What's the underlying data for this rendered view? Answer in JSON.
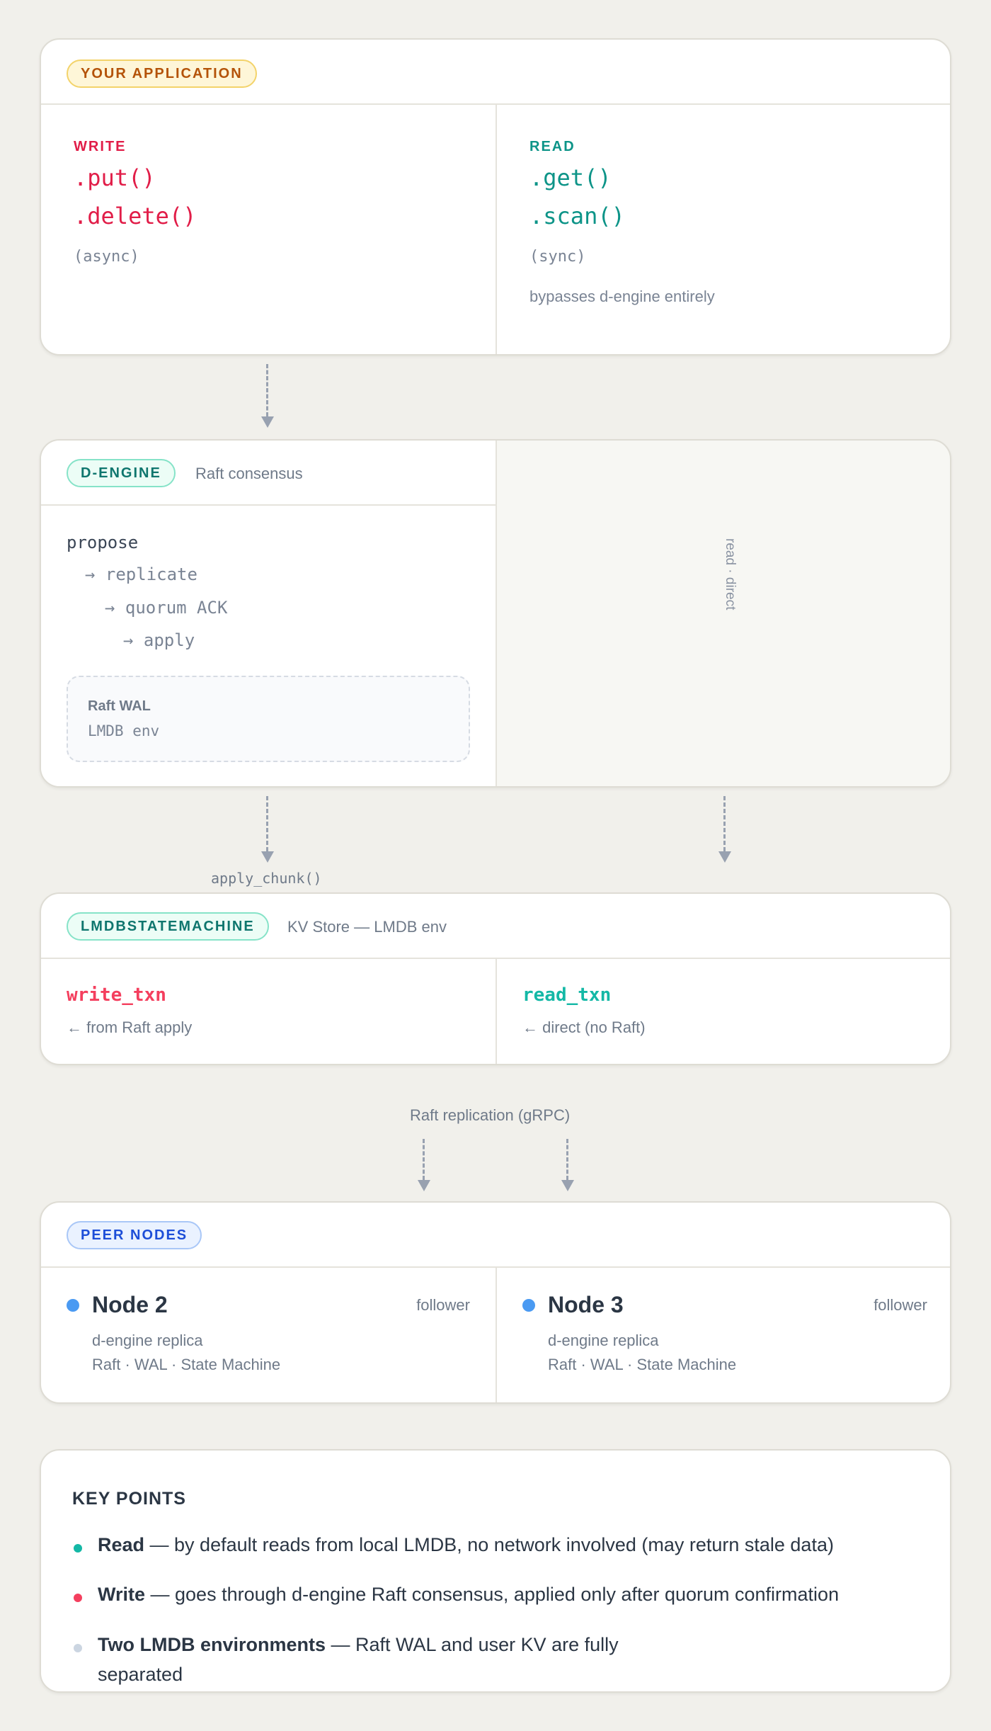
{
  "app": {
    "badge": "YOUR APPLICATION",
    "write": {
      "label": "WRITE",
      "m1": ".put()",
      "m2": ".delete()",
      "mode": "(async)"
    },
    "read": {
      "label": "READ",
      "m1": ".get()",
      "m2": ".scan()",
      "mode": "(sync)",
      "note": "bypasses d-engine entirely"
    }
  },
  "engine": {
    "badge": "D-ENGINE",
    "subtitle": "Raft consensus",
    "steps": [
      "propose",
      "→ replicate",
      "→ quorum ACK",
      "→ apply"
    ],
    "wal_title": "Raft WAL",
    "wal_sub": "LMDB env",
    "side_label": "read · direct"
  },
  "apply_label": "apply_chunk()",
  "sm": {
    "badge": "LMDBSTATEMACHINE",
    "subtitle": "KV Store — LMDB env",
    "write_txn": "write_txn",
    "write_note": "← from Raft apply",
    "read_txn": "read_txn",
    "read_note": "← direct (no Raft)"
  },
  "replication_label": "Raft replication (gRPC)",
  "peers": {
    "badge": "PEER NODES",
    "nodes": [
      {
        "name": "Node 2",
        "role": "follower",
        "l1": "d-engine replica",
        "l2": "Raft · WAL · State Machine"
      },
      {
        "name": "Node 3",
        "role": "follower",
        "l1": "d-engine replica",
        "l2": "Raft · WAL · State Machine"
      }
    ]
  },
  "key_points": {
    "title": "KEY POINTS",
    "items": [
      {
        "bold": "Read",
        "text": " — by default reads from local LMDB, no network involved (may return stale data)"
      },
      {
        "bold": "Write",
        "text": " — goes through d-engine Raft consensus, applied only after quorum confirmation"
      },
      {
        "bold": "Two LMDB environments",
        "text": " — Raft WAL and user KV are fully",
        "text2": "separated"
      }
    ]
  },
  "colors": {
    "write": "#e11d48",
    "read": "#0d9488",
    "peer_dot": "#4a9af2",
    "amber_badge_text": "#b45309",
    "teal_badge_text": "#0f766e",
    "blue_badge_text": "#1d4ed8",
    "bullet_read": "#14b8a6",
    "bullet_write": "#f43f5e",
    "bullet_neutral": "#cbd5e1"
  }
}
